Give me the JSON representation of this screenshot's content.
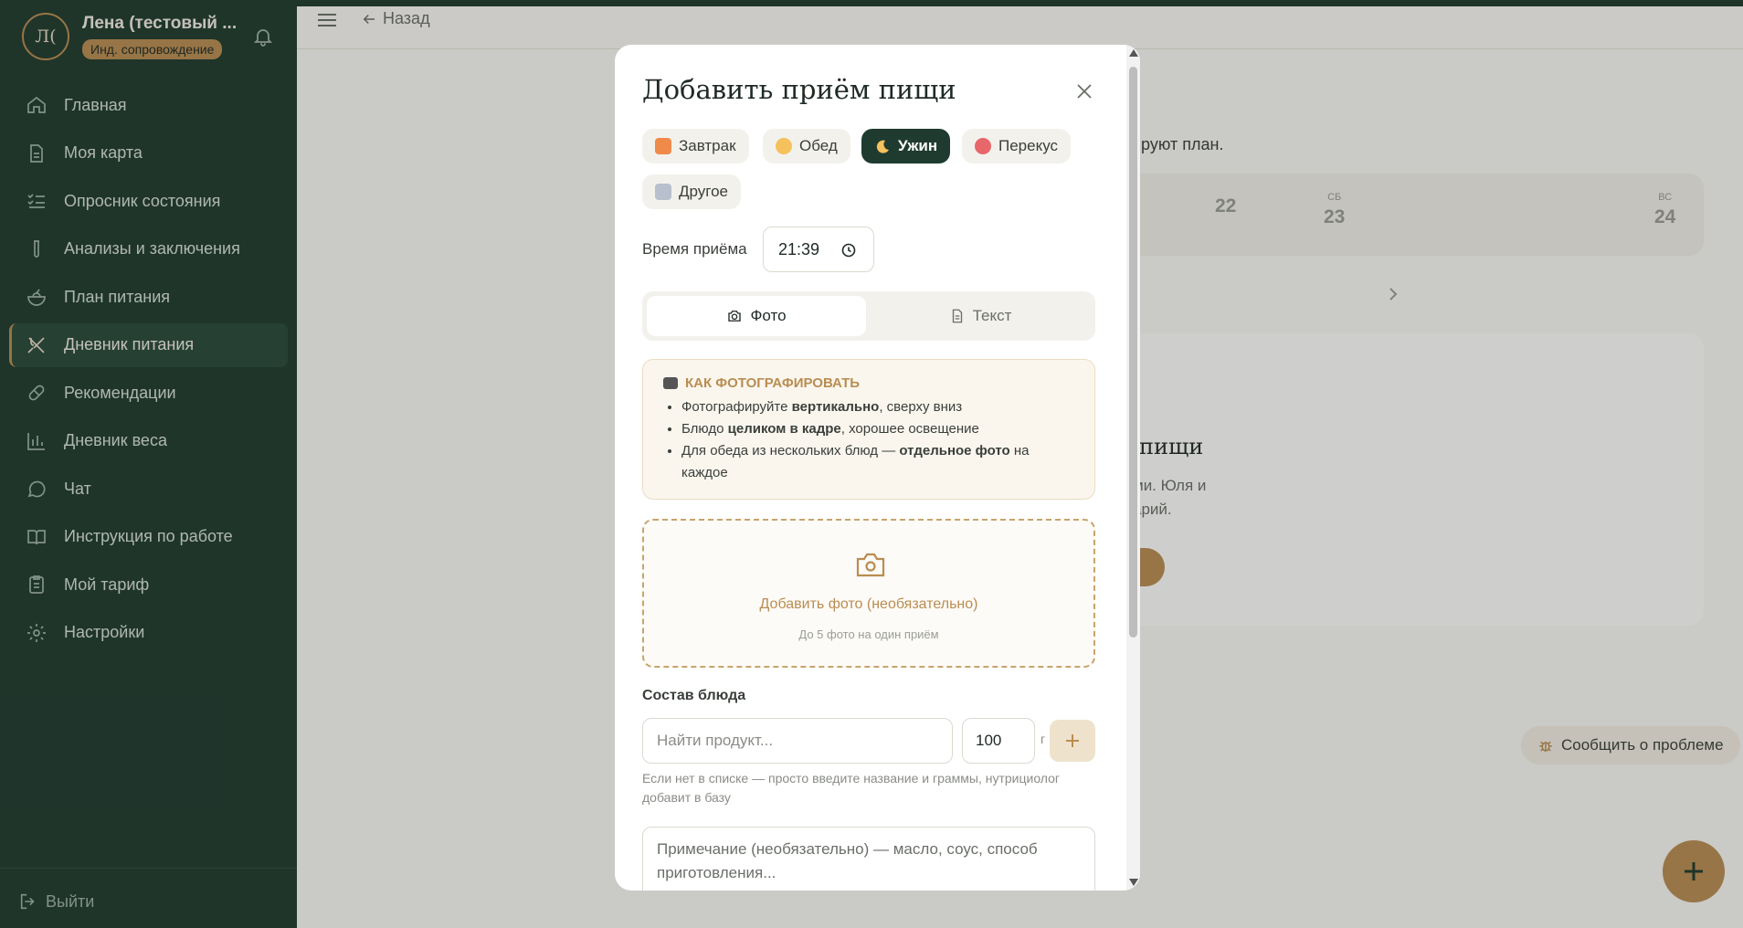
{
  "user": {
    "initials": "Л(",
    "name": "Лена (тестовый ...",
    "badge": "Инд. сопровождение"
  },
  "nav": [
    {
      "label": "Главная",
      "icon": "home-icon"
    },
    {
      "label": "Моя карта",
      "icon": "document-icon"
    },
    {
      "label": "Опросник состояния",
      "icon": "checklist-icon"
    },
    {
      "label": "Анализы и заключения",
      "icon": "test-tube-icon"
    },
    {
      "label": "План питания",
      "icon": "salad-icon"
    },
    {
      "label": "Дневник питания",
      "icon": "utensils-icon"
    },
    {
      "label": "Рекомендации",
      "icon": "pill-icon"
    },
    {
      "label": "Дневник веса",
      "icon": "bar-chart-icon"
    },
    {
      "label": "Чат",
      "icon": "chat-icon"
    },
    {
      "label": "Инструкция по работе",
      "icon": "book-icon"
    },
    {
      "label": "Мой тариф",
      "icon": "clipboard-icon"
    },
    {
      "label": "Настройки",
      "icon": "gear-icon"
    }
  ],
  "logout_label": "Выйти",
  "topbar": {
    "back_label": "Назад"
  },
  "background": {
    "plan_text": "ируют план.",
    "days": [
      {
        "name": "",
        "date": "22"
      },
      {
        "name": "СБ",
        "date": "23"
      },
      {
        "name": "ВС",
        "date": "24"
      }
    ],
    "empty_title": "пищи",
    "empty_sub1": "ми. Юля и",
    "empty_sub2": "арий."
  },
  "report_label": "Сообщить о проблеме",
  "modal": {
    "title": "Добавить приём пищи",
    "meal_types": [
      {
        "label": "Завтрак",
        "color": "#f08a4b"
      },
      {
        "label": "Обед",
        "color": "#f5c15c"
      },
      {
        "label": "Ужин",
        "color": "#f5c15c"
      },
      {
        "label": "Перекус",
        "color": "#e8676b"
      },
      {
        "label": "Другое",
        "color": "#b7c0cc"
      }
    ],
    "selected_meal": "Ужин",
    "time_label": "Время приёма",
    "time_value": "21:39",
    "tabs": {
      "photo": "Фото",
      "text": "Текст"
    },
    "tips": {
      "title": "КАК ФОТОГРАФИРОВАТЬ",
      "t1a": "Фотографируйте ",
      "t1b": "вертикально",
      "t1c": ", сверху вниз",
      "t2a": "Блюдо ",
      "t2b": "целиком в кадре",
      "t2c": ", хорошее освещение",
      "t3a": "Для обеда из нескольких блюд — ",
      "t3b": "отдельное фото",
      "t3c": " на каждое"
    },
    "upload": {
      "text": "Добавить фото (необязательно)",
      "sub": "До 5 фото на один приём"
    },
    "composition": {
      "label": "Состав блюда",
      "search_placeholder": "Найти продукт...",
      "grams_value": "100",
      "unit": "г",
      "hint": "Если нет в списке — просто введите название и граммы, нутрициолог добавит в базу"
    },
    "note_placeholder": "Примечание (необязательно) — масло, соус, способ приготовления..."
  }
}
